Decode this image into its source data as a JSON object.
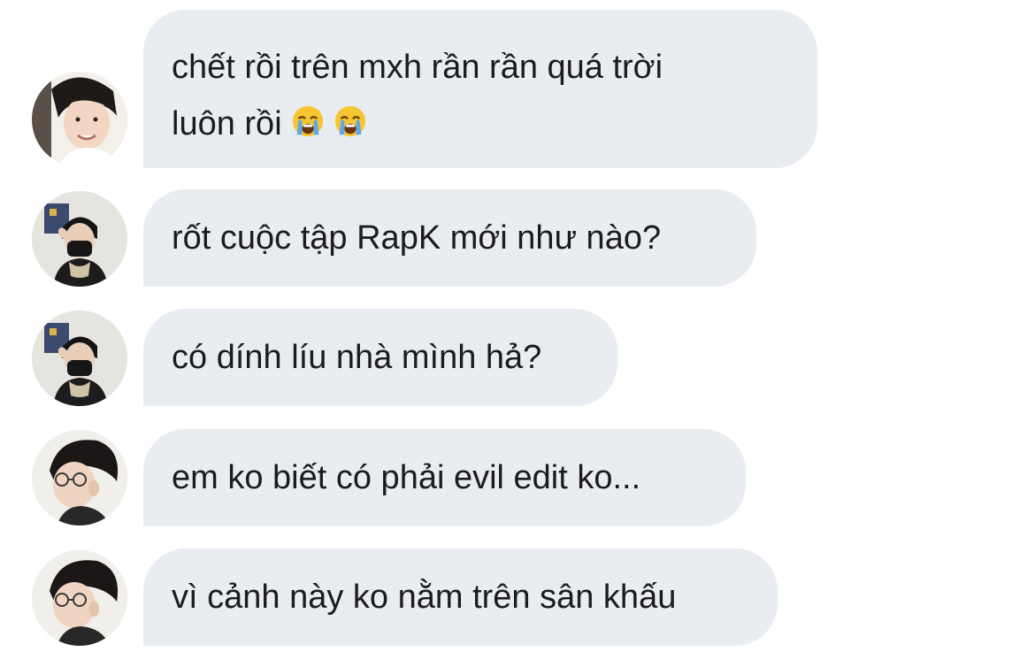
{
  "colors": {
    "bubble_background": "#e9ecf0",
    "text": "#1c1c1e"
  },
  "messages": [
    {
      "avatar": "avatar-user-a",
      "line1": "chết rồi trên mxh rần rần quá trời",
      "line2": "luôn rồi",
      "emojis": [
        "loudly-crying-face-icon",
        "loudly-crying-face-icon"
      ]
    },
    {
      "avatar": "avatar-user-b",
      "text": "rốt cuộc tập RapK mới như nào?"
    },
    {
      "avatar": "avatar-user-b",
      "text": "có dính líu nhà mình hả?"
    },
    {
      "avatar": "avatar-user-c",
      "text": "em ko biết có phải evil edit ko..."
    },
    {
      "avatar": "avatar-user-c",
      "text": "vì cảnh này ko nằm trên sân khấu"
    }
  ]
}
